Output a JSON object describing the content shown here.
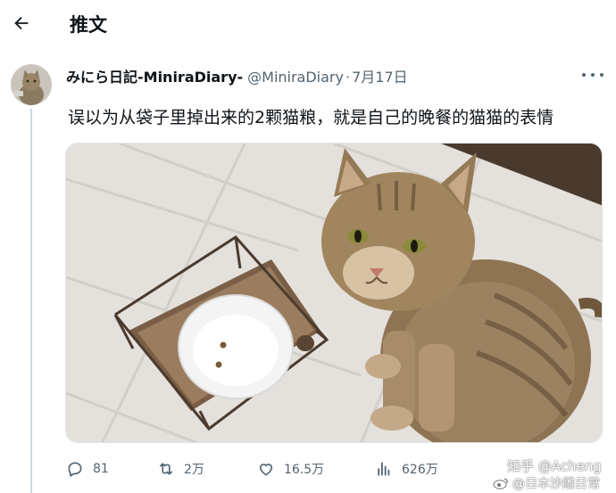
{
  "header": {
    "title": "推文",
    "back_icon": "arrow-left-icon"
  },
  "tweet": {
    "author_name": "みにら日記-MiniraDiary-",
    "author_handle": "@MiniraDiary",
    "separator": "·",
    "date": "7月17日",
    "text": "误以为从袋子里掉出来的2颗猫粮，就是自己的晚餐的猫猫的表情",
    "media_description_icon": "cat-photo"
  },
  "actions": {
    "reply": {
      "icon": "reply-icon",
      "count": "81"
    },
    "retweet": {
      "icon": "retweet-icon",
      "count": "2万"
    },
    "like": {
      "icon": "heart-icon",
      "count": "16.5万"
    },
    "views": {
      "icon": "views-icon",
      "count": "626万"
    }
  },
  "watermark": {
    "line1": "知乎 @Acheng",
    "line2": "@日本沙雕日常"
  },
  "colors": {
    "text": "#0f1419",
    "secondary": "#536471",
    "border": "#cfd9de"
  }
}
